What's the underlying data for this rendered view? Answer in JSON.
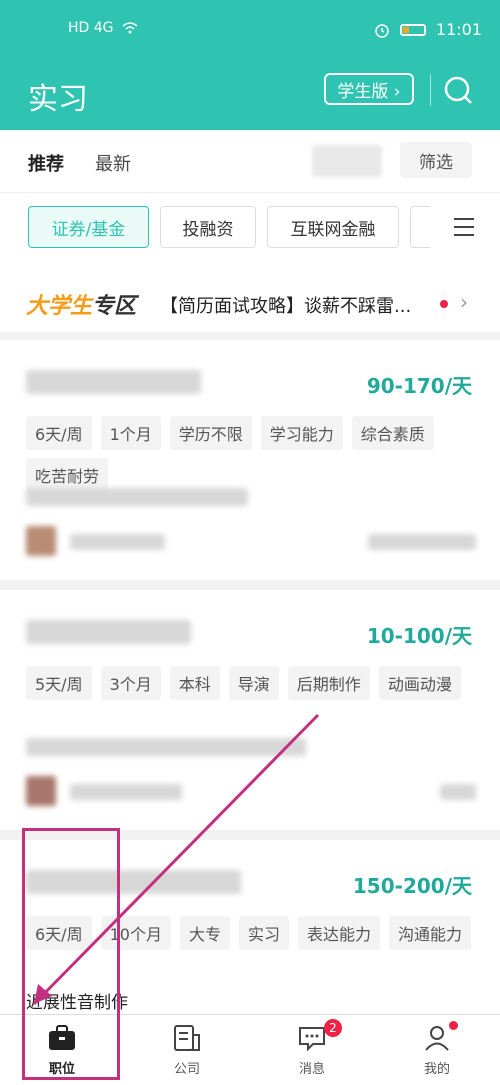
{
  "status_bar": {
    "signal": "HD 4G",
    "time": "11:01"
  },
  "header": {
    "title": "实习",
    "student_button": "学生版 ›"
  },
  "tabs": {
    "active": "推荐",
    "second": "最新",
    "filter": "筛选"
  },
  "chips": [
    "证券/基金",
    "投融资",
    "互联网金融"
  ],
  "banner": {
    "logo_part1": "大学生",
    "logo_part2": "专区",
    "text": "【简历面试攻略】谈薪不踩雷..."
  },
  "cards": [
    {
      "salary": "90-170/天",
      "tags": [
        "6天/周",
        "1个月",
        "学历不限",
        "学习能力",
        "综合素质",
        "吃苦耐劳"
      ]
    },
    {
      "salary": "10-100/天",
      "tags": [
        "5天/周",
        "3个月",
        "本科",
        "导演",
        "后期制作",
        "动画动漫"
      ]
    },
    {
      "salary": "150-200/天",
      "tags": [
        "6天/周",
        "10个月",
        "大专",
        "实习",
        "表达能力",
        "沟通能力"
      ]
    }
  ],
  "partial_text": "近展性音制作",
  "nav": [
    {
      "label": "职位"
    },
    {
      "label": "公司"
    },
    {
      "label": "消息",
      "badge": "2"
    },
    {
      "label": "我的"
    }
  ],
  "colors": {
    "accent": "#2ec4b1",
    "salary": "#21a99a",
    "annotation": "#c2307f"
  }
}
